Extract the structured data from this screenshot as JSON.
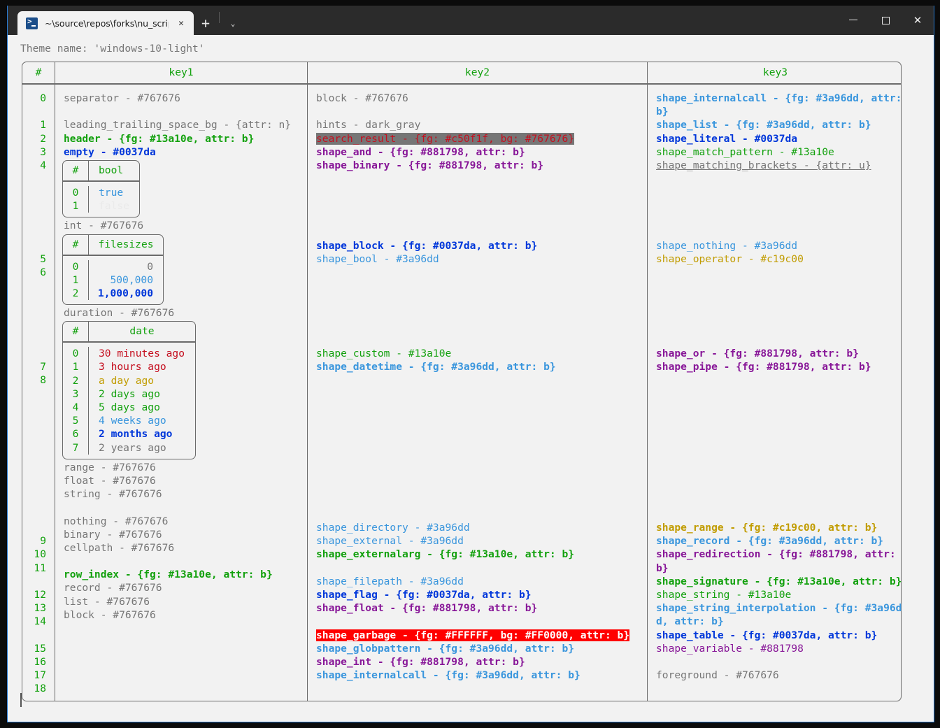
{
  "window": {
    "tab_title": "~\\source\\repos\\forks\\nu_scrip",
    "tab_icon": "powershell-icon",
    "close_tab_label": "✕",
    "new_tab_label": "+",
    "dropdown_label": "⌄",
    "minimize_label": "—",
    "maximize_label": "□",
    "close_label": "✕"
  },
  "terminal": {
    "theme_line": "Theme name: 'windows-10-light'",
    "prompt_cursor": ""
  },
  "table": {
    "headers": [
      "#",
      "key1",
      "key2",
      "key3"
    ],
    "row_numbers": [
      "0",
      "1",
      "2",
      "3",
      "4",
      "5",
      "6",
      "7",
      "8",
      "9",
      "10",
      "11",
      "12",
      "13",
      "14",
      "15",
      "16",
      "17",
      "18"
    ],
    "key1": [
      "separator - #767676",
      "leading_trailing_space_bg - {attr: n}",
      "header - {fg: #13a10e, attr: b}",
      "empty - #0037da",
      "int - #767676",
      "duration - #767676",
      "range - #767676",
      "float - #767676",
      "string - #767676",
      "nothing - #767676",
      "binary - #767676",
      "cellpath - #767676",
      "row_index - {fg: #13a10e, attr: b}",
      "record - #767676",
      "list - #767676",
      "block - #767676"
    ],
    "key2": [
      "block - #767676",
      "hints - dark_gray",
      "search_result - {fg: #c50f1f, bg: #767676}",
      "shape_and - {fg: #881798, attr: b}",
      "shape_binary - {fg: #881798, attr: b}",
      "shape_block - {fg: #0037da, attr: b}",
      "shape_bool - #3a96dd",
      "shape_custom - #13a10e",
      "shape_datetime - {fg: #3a96dd, attr: b}",
      "shape_directory - #3a96dd",
      "shape_external - #3a96dd",
      "shape_externalarg - {fg: #13a10e, attr: b}",
      "shape_filepath - #3a96dd",
      "shape_flag - {fg: #0037da, attr: b}",
      "shape_float - {fg: #881798, attr: b}",
      "shape_garbage - {fg: #FFFFFF, bg: #FF0000, attr: b}",
      "shape_globpattern - {fg: #3a96dd, attr: b}",
      "shape_int - {fg: #881798, attr: b}",
      "shape_internalcall - {fg: #3a96dd, attr: b}"
    ],
    "key3": [
      "shape_internalcall - {fg: #3a96dd, attr: b}",
      "shape_list - {fg: #3a96dd, attr: b}",
      "shape_literal - #0037da",
      "shape_match_pattern - #13a10e",
      "shape_matching_brackets - {attr: u}",
      "shape_nothing - #3a96dd",
      "shape_operator - #c19c00",
      "shape_or - {fg: #881798, attr: b}",
      "shape_pipe - {fg: #881798, attr: b}",
      "shape_range - {fg: #c19c00, attr: b}",
      "shape_record - {fg: #3a96dd, attr: b}",
      "shape_redirection - {fg: #881798, attr: b}",
      "shape_signature - {fg: #13a10e, attr: b}",
      "shape_string - #13a10e",
      "shape_string_interpolation - {fg: #3a96dd, attr: b}",
      "shape_table - {fg: #0037da, attr: b}",
      "shape_variable - #881798",
      "foreground - #767676"
    ]
  },
  "nested_bool": {
    "headers": [
      "#",
      "bool"
    ],
    "indices": [
      "0",
      "1"
    ],
    "values": [
      "true",
      "false"
    ]
  },
  "nested_filesizes": {
    "headers": [
      "#",
      "filesizes"
    ],
    "indices": [
      "0",
      "1",
      "2"
    ],
    "values": [
      "0",
      "500,000",
      "1,000,000"
    ]
  },
  "nested_date": {
    "headers": [
      "#",
      "date"
    ],
    "indices": [
      "0",
      "1",
      "2",
      "3",
      "4",
      "5",
      "6",
      "7"
    ],
    "values": [
      "30 minutes ago",
      "3 hours ago",
      "a day ago",
      "2 days ago",
      "5 days ago",
      "4 weeks ago",
      "2 months ago",
      "2 years ago"
    ]
  },
  "colors": {
    "gray": "#767676",
    "green": "#13a10e",
    "blue": "#0037da",
    "cyan": "#3a96dd",
    "purple": "#881798",
    "yellow": "#c19c00",
    "red": "#c50f1f",
    "bg_highlight_gray": "#767676",
    "bg_highlight_red": "#FF0000",
    "white": "#FFFFFF"
  }
}
